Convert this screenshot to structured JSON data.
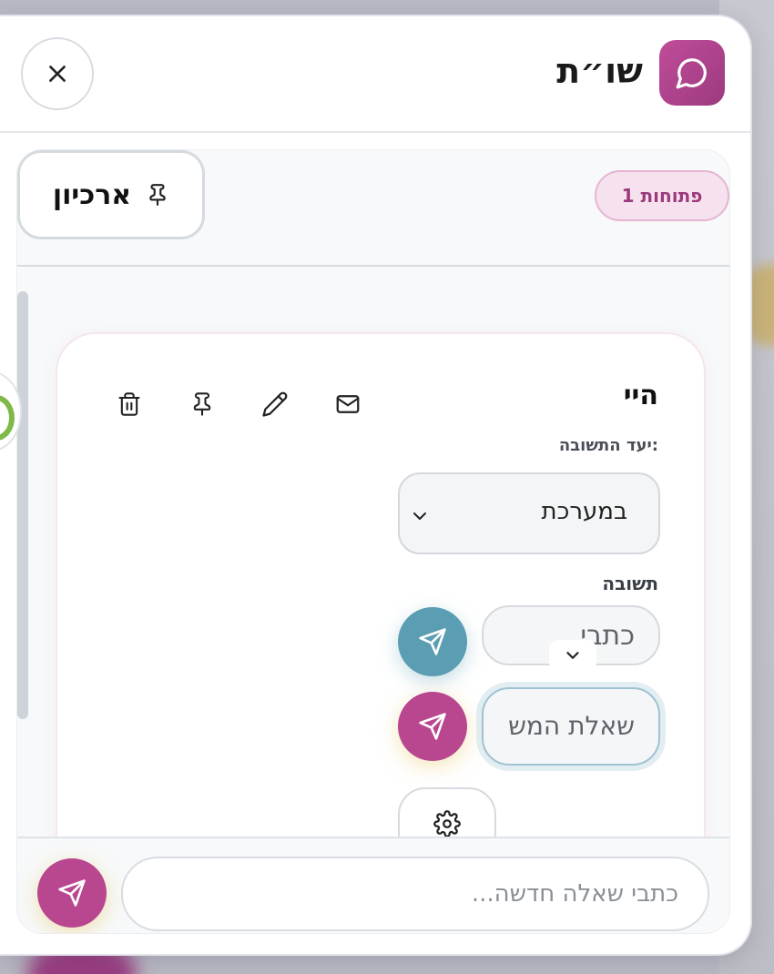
{
  "header": {
    "title": "שו״ת",
    "logo_icon": "chat-bubble-icon",
    "close_icon": "close-icon",
    "accent": "#b8478f"
  },
  "toolbar": {
    "archive_label": "ארכיון",
    "archive_icon": "pin-icon",
    "open_badge": "1 פתוחות"
  },
  "card": {
    "title": "היי",
    "actions": [
      {
        "name": "email-icon"
      },
      {
        "name": "edit-icon"
      },
      {
        "name": "pin-icon"
      },
      {
        "name": "trash-icon"
      }
    ],
    "target_label": "יעד התשובה:",
    "target_value": "במערכת",
    "answer_label": "תשובה",
    "answer_field1": "כתבי",
    "answer_field2": "שאלת המש",
    "send_blue_color": "#5b9db2",
    "send_pink_color": "#b8478f"
  },
  "composer": {
    "placeholder": "כתבי שאלה חדשה...",
    "send_icon": "send-icon"
  }
}
